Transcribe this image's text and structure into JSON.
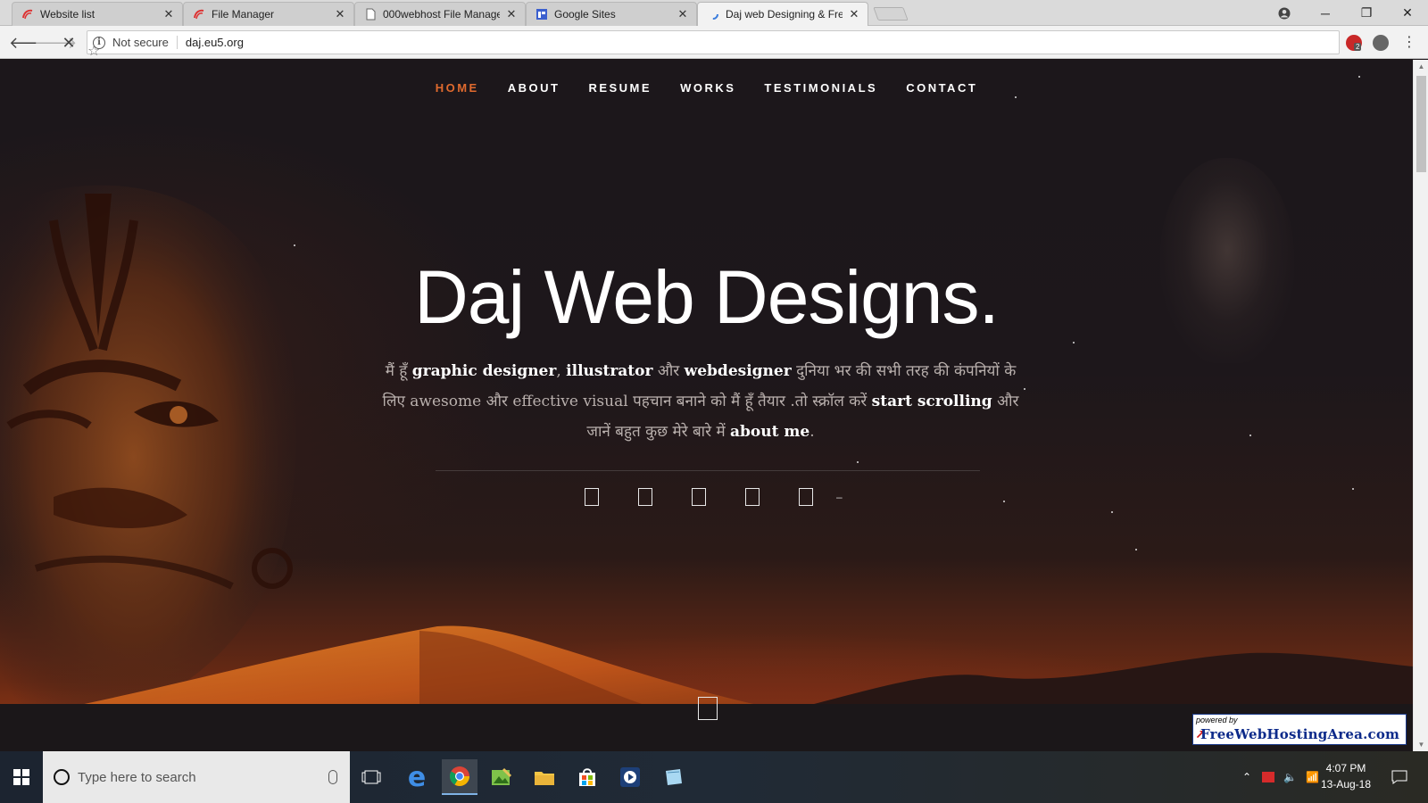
{
  "browser": {
    "tabs": [
      {
        "title": "Website list",
        "favicon": "webhost-icon",
        "active": false
      },
      {
        "title": "File Manager",
        "favicon": "webhost-icon",
        "active": false
      },
      {
        "title": "000webhost File Manage",
        "favicon": "page-icon",
        "active": false
      },
      {
        "title": "Google Sites",
        "favicon": "google-sites-icon",
        "active": false
      },
      {
        "title": "Daj web Designing & Fre",
        "favicon": "loading-icon",
        "active": true
      }
    ],
    "security_label": "Not secure",
    "url": "daj.eu5.org",
    "extension_badge": "2"
  },
  "site": {
    "nav": [
      {
        "label": "HOME",
        "current": true
      },
      {
        "label": "ABOUT",
        "current": false
      },
      {
        "label": "RESUME",
        "current": false
      },
      {
        "label": "WORKS",
        "current": false
      },
      {
        "label": "TESTIMONIALS",
        "current": false
      },
      {
        "label": "CONTACT",
        "current": false
      }
    ],
    "hero_title": "Daj Web Designs.",
    "intro": {
      "p1": "मैं हूँ ",
      "b1": "graphic designer",
      "p2": ", ",
      "b2": "illustrator",
      "p3": " और ",
      "b3": "webdesigner",
      "p4": " दुनिया भर की सभी तरह की कंपनियों के लिए awesome और effective visual पहचान बनाने को मैं हूँ तैयार .तो स्क्रॉल करें ",
      "b4": "start scrolling",
      "p5": " और जानें बहुत कुछ मेरे बारे में ",
      "b5": "about me",
      "p6": "."
    },
    "social_icon_count": 5,
    "host_badge": {
      "powered": "powered by",
      "name": "FreeWebHostingArea.com"
    }
  },
  "taskbar": {
    "search_placeholder": "Type here to search",
    "time": "4:07 PM",
    "date": "13-Aug-18"
  },
  "colors": {
    "nav_active": "#e06a2e",
    "page_bg": "#1b1519",
    "desert_glow": "#b9441a"
  }
}
